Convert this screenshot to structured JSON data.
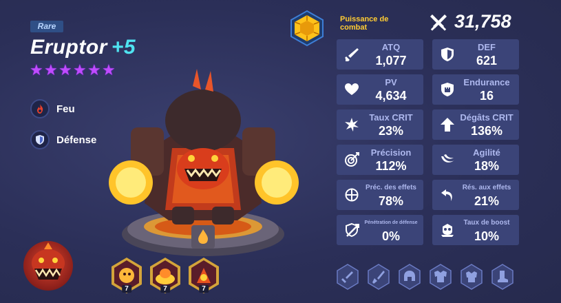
{
  "hero": {
    "rarity": "Rare",
    "name": "Eruptor",
    "level": "+5",
    "stars": 6,
    "element": "Feu",
    "role": "Défense"
  },
  "combat": {
    "label": "Puissance de combat",
    "value": "31,758"
  },
  "stats": [
    {
      "label": "ATQ",
      "value": "1,077",
      "icon": "sword-icon"
    },
    {
      "label": "DEF",
      "value": "621",
      "icon": "shield-icon"
    },
    {
      "label": "PV",
      "value": "4,634",
      "icon": "heart-icon"
    },
    {
      "label": "Endurance",
      "value": "16",
      "icon": "fortress-icon"
    },
    {
      "label": "Taux CRIT",
      "value": "23%",
      "icon": "burst-icon"
    },
    {
      "label": "Dégâts CRIT",
      "value": "136%",
      "icon": "arrow-up-icon"
    },
    {
      "label": "Précision",
      "value": "112%",
      "icon": "target-icon"
    },
    {
      "label": "Agilité",
      "value": "18%",
      "icon": "swoosh-icon"
    },
    {
      "label": "Préc. des effets",
      "value": "78%",
      "icon": "crosshair-icon"
    },
    {
      "label": "Rés. aux effets",
      "value": "21%",
      "icon": "return-arrow-icon"
    },
    {
      "label": "Pénétration de défense",
      "value": "0%",
      "icon": "pierce-icon"
    },
    {
      "label": "Taux de boost",
      "value": "10%",
      "icon": "skull-boost-icon"
    }
  ],
  "skills": [
    {
      "level": "7",
      "icon": "fire-fist-skill-icon"
    },
    {
      "level": "7",
      "icon": "lava-pool-skill-icon"
    },
    {
      "level": "7",
      "icon": "eruption-skill-icon"
    }
  ],
  "equipment": [
    "sword-slot-icon",
    "dagger-slot-icon",
    "helmet-slot-icon",
    "armor-slot-icon",
    "gauntlet-slot-icon",
    "boots-slot-icon"
  ],
  "colors": {
    "accent_level": "#4fe3f0",
    "stars": "#c04bff",
    "combat_label": "#ffcc33",
    "card": "#3b4478",
    "stat_label": "#aeb8ee"
  }
}
